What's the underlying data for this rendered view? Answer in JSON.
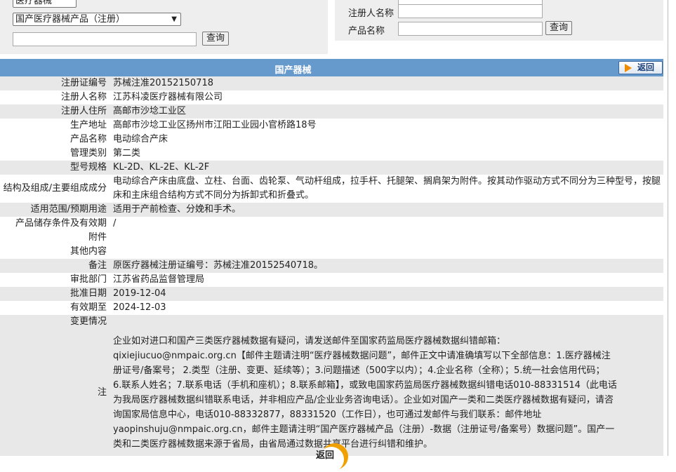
{
  "search_left": {
    "category_select": "医疗器械",
    "type_select": "国产医疗器械产品（注册）",
    "keyword_value": "",
    "query_label": "查询"
  },
  "search_right": {
    "registrant_label": "注册人名称",
    "registrant_value": "",
    "product_label": "产品名称",
    "product_value": "",
    "query_label": "查询"
  },
  "header": {
    "title": "国产器械",
    "back_label": "返回"
  },
  "rows": [
    {
      "label": "注册证编号",
      "value": "苏械注准20152150718"
    },
    {
      "label": "注册人名称",
      "value": "江苏科凌医疗器械有限公司"
    },
    {
      "label": "注册人住所",
      "value": "高邮市沙埝工业区"
    },
    {
      "label": "生产地址",
      "value": "高邮市沙埝工业区扬州市江阳工业园小官桥路18号"
    },
    {
      "label": "产品名称",
      "value": "电动综合产床"
    },
    {
      "label": "管理类别",
      "value": "第二类"
    },
    {
      "label": "型号规格",
      "value": "KL-2D、KL-2E、KL-2F"
    },
    {
      "label": "结构及组成/主要组成成分",
      "value": "电动综合产床由底盘、立柱、台面、齿轮泵、气动杆组成，拉手杆、托腿架、搁肩架为附件。按其动作驱动方式不同分为三种型号，按腿床和主床组合结构方式不同分为拆卸式和折叠式。"
    },
    {
      "label": "适用范围/预期用途",
      "value": "适用于产前检查、分娩和手术。"
    },
    {
      "label": "产品储存条件及有效期",
      "value": "/"
    },
    {
      "label": "附件",
      "value": ""
    },
    {
      "label": "其他内容",
      "value": ""
    },
    {
      "label": "备注",
      "value": "原医疗器械注册证编号：苏械注准20152540718。"
    },
    {
      "label": "审批部门",
      "value": "江苏省药品监督管理局"
    },
    {
      "label": "批准日期",
      "value": "2019-12-04"
    },
    {
      "label": "有效期至",
      "value": "2024-12-03"
    },
    {
      "label": "变更情况",
      "value": ""
    }
  ],
  "note": {
    "label": "注",
    "lines": [
      "企业如对进口和国产三类医疗器械数据有疑问，请发送邮件至国家药监局医疗器械数据纠错邮箱：",
      "qixiejiucuo@nmpaic.org.cn【邮件主题请注明“医疗器械数据问题”，邮件正文中请准确填写以下全部信息：1.医疗器械注",
      "册证号/备案号； 2.类型（注册、变更、延续等）；3.问题描述（500字以内）；4.企业名称（全称）；5.统一社会信用代码；",
      "6.联系人姓名；7.联系电话（手机和座机）；8.联系邮箱】，或致电国家药监局医疗器械数据纠错电话010-88331514（此电话",
      "为我局医疗器械数据纠错联系电话，并非相应产品/企业业务咨询电话）。企业如对国产一类和二类医疗器械数据有疑问，请咨",
      "询国家局信息中心，电话010-88332877，88331520（工作日），也可通过发邮件与我们联系：邮件地址",
      "yaopinshuju@nmpaic.org.cn，邮件主题请注明“国产医疗器械产品（注册）-数据（注册证号/备案号）数据问题”。国产一",
      "类和二类医疗器械数据来源于省局，由省局通过数据共享平台进行纠错和维护。"
    ]
  },
  "footer": {
    "back_label": "返回"
  }
}
